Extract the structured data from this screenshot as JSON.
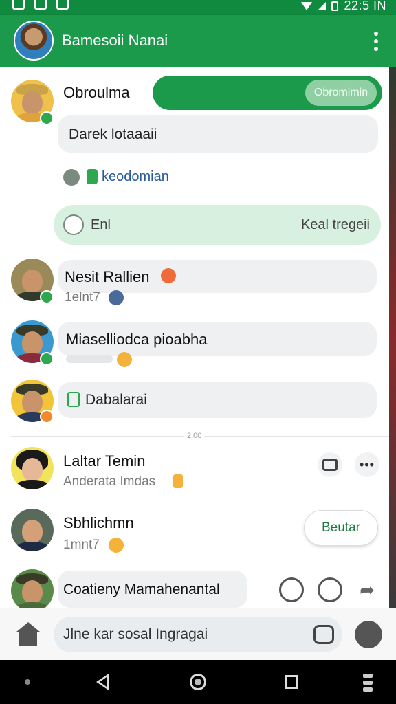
{
  "status_bar": {
    "time": "22:5 IN"
  },
  "app_bar": {
    "title": "Bamesoii Nanai"
  },
  "feed": {
    "post1": {
      "name": "Obroulma",
      "header_button": "Obromimin",
      "message": "Darek lotaaaii",
      "link_text": "keodomian",
      "action_left": "Enl",
      "action_right": "Keal tregeii"
    },
    "post2": {
      "message": "Nesit Rallien",
      "sub": "1elnt7"
    },
    "post3": {
      "message": "Miaselliodca pioabha"
    },
    "post4": {
      "message": "Dabalarai"
    },
    "divider_label": "2:00",
    "contact1": {
      "name": "Laltar Temin",
      "sub": "Anderata Imdas"
    },
    "contact2": {
      "name": "Sbhlichmn",
      "sub": "1mnt7",
      "button": "Beutar"
    },
    "contact3": {
      "name": "Coatieny Mamahenantal"
    }
  },
  "input_bar": {
    "placeholder": "Jlne kar sosal Ingragai"
  },
  "colors": {
    "primary_green": "#1a9a4a",
    "light_green": "#d8f0df"
  }
}
